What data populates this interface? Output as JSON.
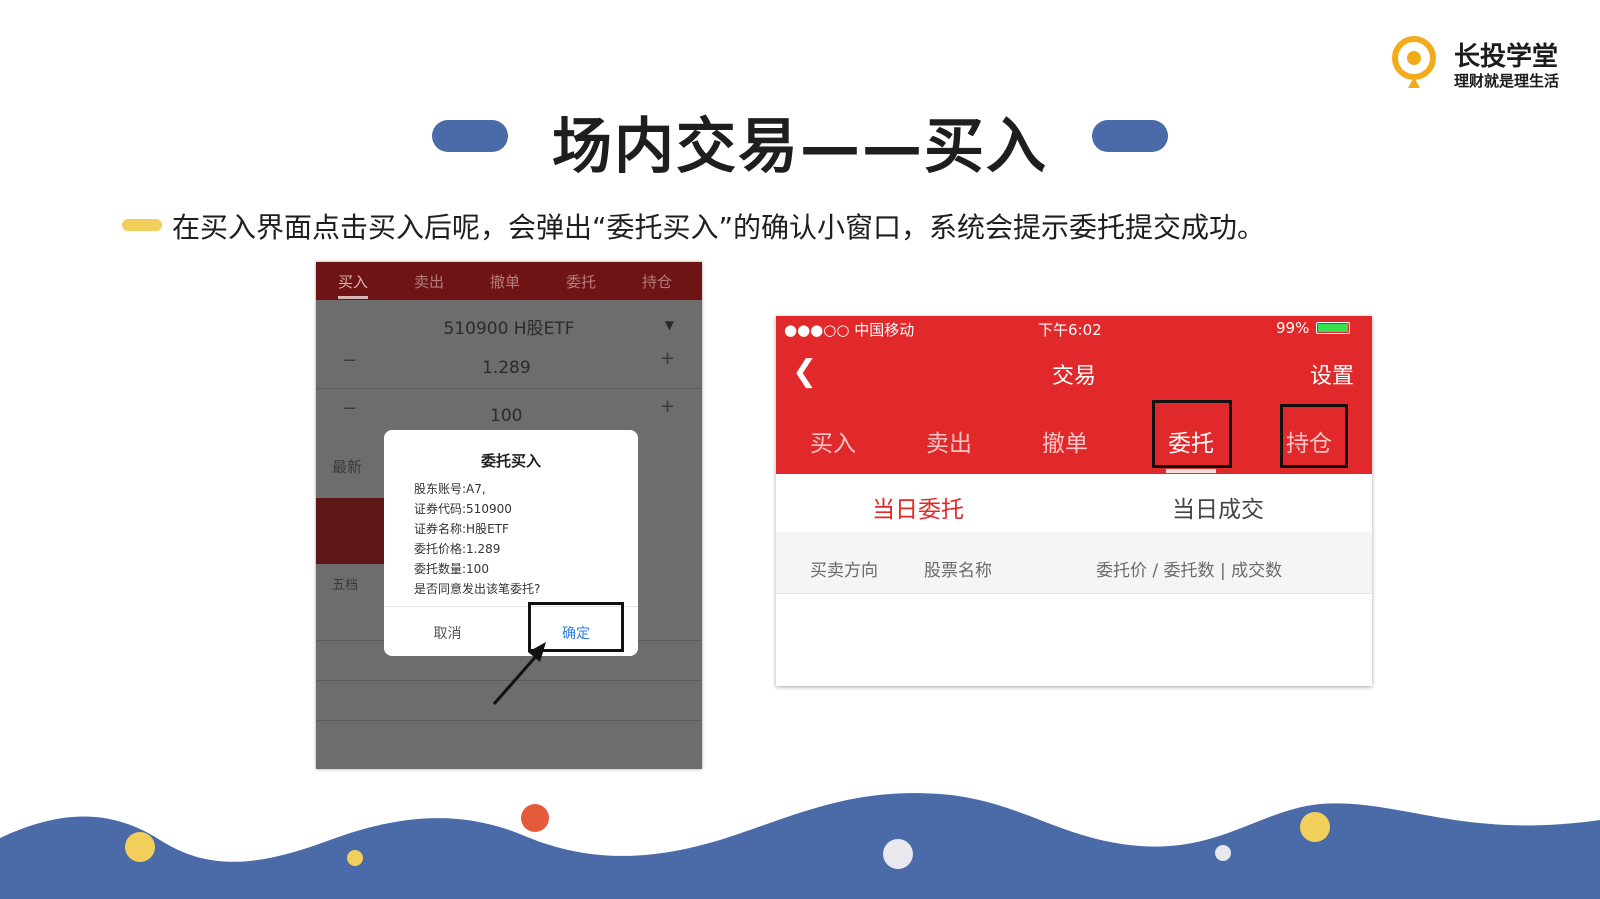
{
  "logo": {
    "name": "长投学堂",
    "slogan": "理财就是理生活"
  },
  "title": "场内交易——买入",
  "description": "在买入界面点击买入后呢，会弹出“委托买入”的确认小窗口，系统会提示委托提交成功。",
  "left_screenshot": {
    "tabs": [
      "买入",
      "卖出",
      "撤单",
      "委托",
      "持仓"
    ],
    "active_tab": "买入",
    "stock": "510900 H股ETF",
    "price": "1.289",
    "quantity": "100",
    "labels": {
      "latest": "最新",
      "five_levels": "五档"
    },
    "dialog": {
      "title": "委托买入",
      "lines": [
        "股东账号:A7,",
        "证券代码:510900",
        "证券名称:H股ETF",
        "委托价格:1.289",
        "委托数量:100",
        "是否同意发出该笔委托?"
      ],
      "cancel": "取消",
      "confirm": "确定"
    }
  },
  "right_screenshot": {
    "status": {
      "carrier": "●●●○○ 中国移动",
      "time": "下午6:02",
      "battery": "99%",
      "battery_level": 0.99
    },
    "nav_title": "交易",
    "settings": "设置",
    "tabs": [
      "买入",
      "卖出",
      "撤单",
      "委托",
      "持仓"
    ],
    "active_tab": "委托",
    "subtabs": [
      "当日委托",
      "当日成交"
    ],
    "active_subtab": "当日委托",
    "columns": [
      "买卖方向",
      "股票名称",
      "委托价 / 委托数 | 成交数"
    ]
  },
  "colors": {
    "accent_blue": "#4a6aa8",
    "accent_yellow": "#f1cf5a",
    "app_red": "#e1282a",
    "dialog_confirm_blue": "#2f7de1",
    "wave_dot_orange": "#e55a3a"
  }
}
